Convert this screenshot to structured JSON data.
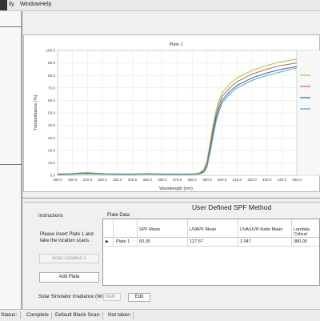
{
  "menu": {
    "items": [
      "ily",
      "Window",
      "Help"
    ]
  },
  "chart_data": {
    "type": "line",
    "title": "Plate 1",
    "xlabel": "Wavelength (nm)",
    "ylabel": "Transmittance (%)",
    "xlim": [
      290,
      450
    ],
    "ylim": [
      0,
      100
    ],
    "x_ticks": [
      "290.0",
      "300.0",
      "310.0",
      "320.0",
      "330.0",
      "340.0",
      "350.0",
      "360.0",
      "370.0",
      "380.0",
      "390.0",
      "400.0",
      "410.0",
      "420.0",
      "430.0",
      "440.0",
      "450.0"
    ],
    "y_ticks": [
      "0.0",
      "10.0",
      "20.0",
      "30.0",
      "40.0",
      "50.0",
      "60.0",
      "70.0",
      "80.0",
      "90.0",
      "100.0"
    ],
    "grid": true,
    "legend": "right",
    "series": [
      {
        "color": "#90d040",
        "x": [
          290,
          300,
          305,
          310,
          320,
          330,
          340,
          350,
          360,
          370,
          380,
          385,
          388,
          390,
          392,
          394,
          396,
          398,
          400,
          405,
          410,
          420,
          430,
          440,
          450
        ],
        "y": [
          1,
          1.5,
          2,
          2.2,
          1.5,
          1,
          1,
          1.5,
          1,
          1,
          1,
          2,
          5,
          12,
          26,
          40,
          52,
          60,
          66,
          73,
          78,
          84,
          88,
          91,
          93
        ]
      },
      {
        "color": "#e06030",
        "x": [
          290,
          300,
          305,
          310,
          320,
          330,
          340,
          350,
          360,
          370,
          380,
          385,
          388,
          390,
          392,
          394,
          396,
          398,
          400,
          405,
          410,
          420,
          430,
          440,
          450
        ],
        "y": [
          1,
          1,
          1.5,
          1.8,
          1.2,
          1,
          1,
          1.2,
          1,
          1,
          1,
          1.5,
          4,
          10,
          23,
          37,
          49,
          57,
          63,
          70,
          75,
          81,
          85,
          88,
          90
        ]
      },
      {
        "color": "#3060c0",
        "x": [
          290,
          300,
          305,
          310,
          320,
          330,
          340,
          350,
          360,
          370,
          380,
          385,
          388,
          390,
          392,
          394,
          396,
          398,
          400,
          405,
          410,
          420,
          430,
          440,
          450
        ],
        "y": [
          0.5,
          1,
          1.2,
          1.5,
          1,
          0.8,
          0.8,
          1,
          0.8,
          0.8,
          0.8,
          1.2,
          3,
          8,
          20,
          34,
          46,
          54,
          60,
          67,
          72,
          78,
          82,
          85,
          87
        ]
      },
      {
        "color": "#40b0c0",
        "x": [
          290,
          300,
          305,
          310,
          320,
          330,
          340,
          350,
          360,
          370,
          380,
          385,
          388,
          390,
          392,
          394,
          396,
          398,
          400,
          405,
          410,
          420,
          430,
          440,
          450
        ],
        "y": [
          0.5,
          0.8,
          1,
          1.2,
          0.9,
          0.7,
          0.7,
          0.9,
          0.7,
          0.7,
          0.7,
          1,
          2.5,
          7,
          18,
          31,
          43,
          51,
          58,
          65,
          70,
          76,
          80,
          83,
          86
        ]
      }
    ]
  },
  "spf": {
    "title": "User Defined SPF Method",
    "instructions_title": "Instructions",
    "instructions_text": "Please insert Plate 1 and take the location scans.",
    "scan_button": "Scan Location 1",
    "add_plate_button": "Add Plate",
    "irradiance_label": "Solar Simulator Irradiance (W/m2)",
    "irradiance_placeholder": "NaN",
    "edit_button": "Edit",
    "plate_data_label": "Plate Data",
    "columns": [
      "SPF Mean",
      "UVAPF Mean",
      "UVA/UVB Ratio Mean",
      "Lambda Critical"
    ],
    "rows": [
      {
        "marker": "▶",
        "name": "Plate 1",
        "values": [
          "60.35",
          "127.67",
          "1.047",
          "380.00"
        ]
      }
    ]
  },
  "statusbar": {
    "status_label": "Status:",
    "status_value": "Complete",
    "blank_label": "Default Blank Scan:",
    "blank_value": "Not taken"
  }
}
